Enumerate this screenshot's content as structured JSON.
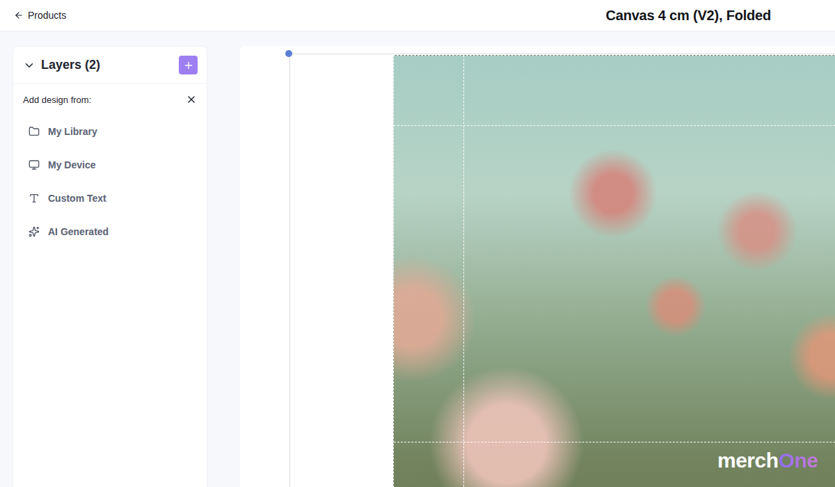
{
  "topbar": {
    "back": "Products",
    "title": "Canvas 4 cm (V2), Folded"
  },
  "layers": {
    "title": "Layers (2)",
    "expanded": true
  },
  "add_design": {
    "label": "Add design from:",
    "sources": [
      {
        "label": "My Library"
      },
      {
        "label": "My Device"
      },
      {
        "label": "Custom Text"
      },
      {
        "label": "AI Generated"
      }
    ]
  },
  "canvas": {
    "watermark": {
      "brand": "merch",
      "accent": "One"
    }
  }
}
